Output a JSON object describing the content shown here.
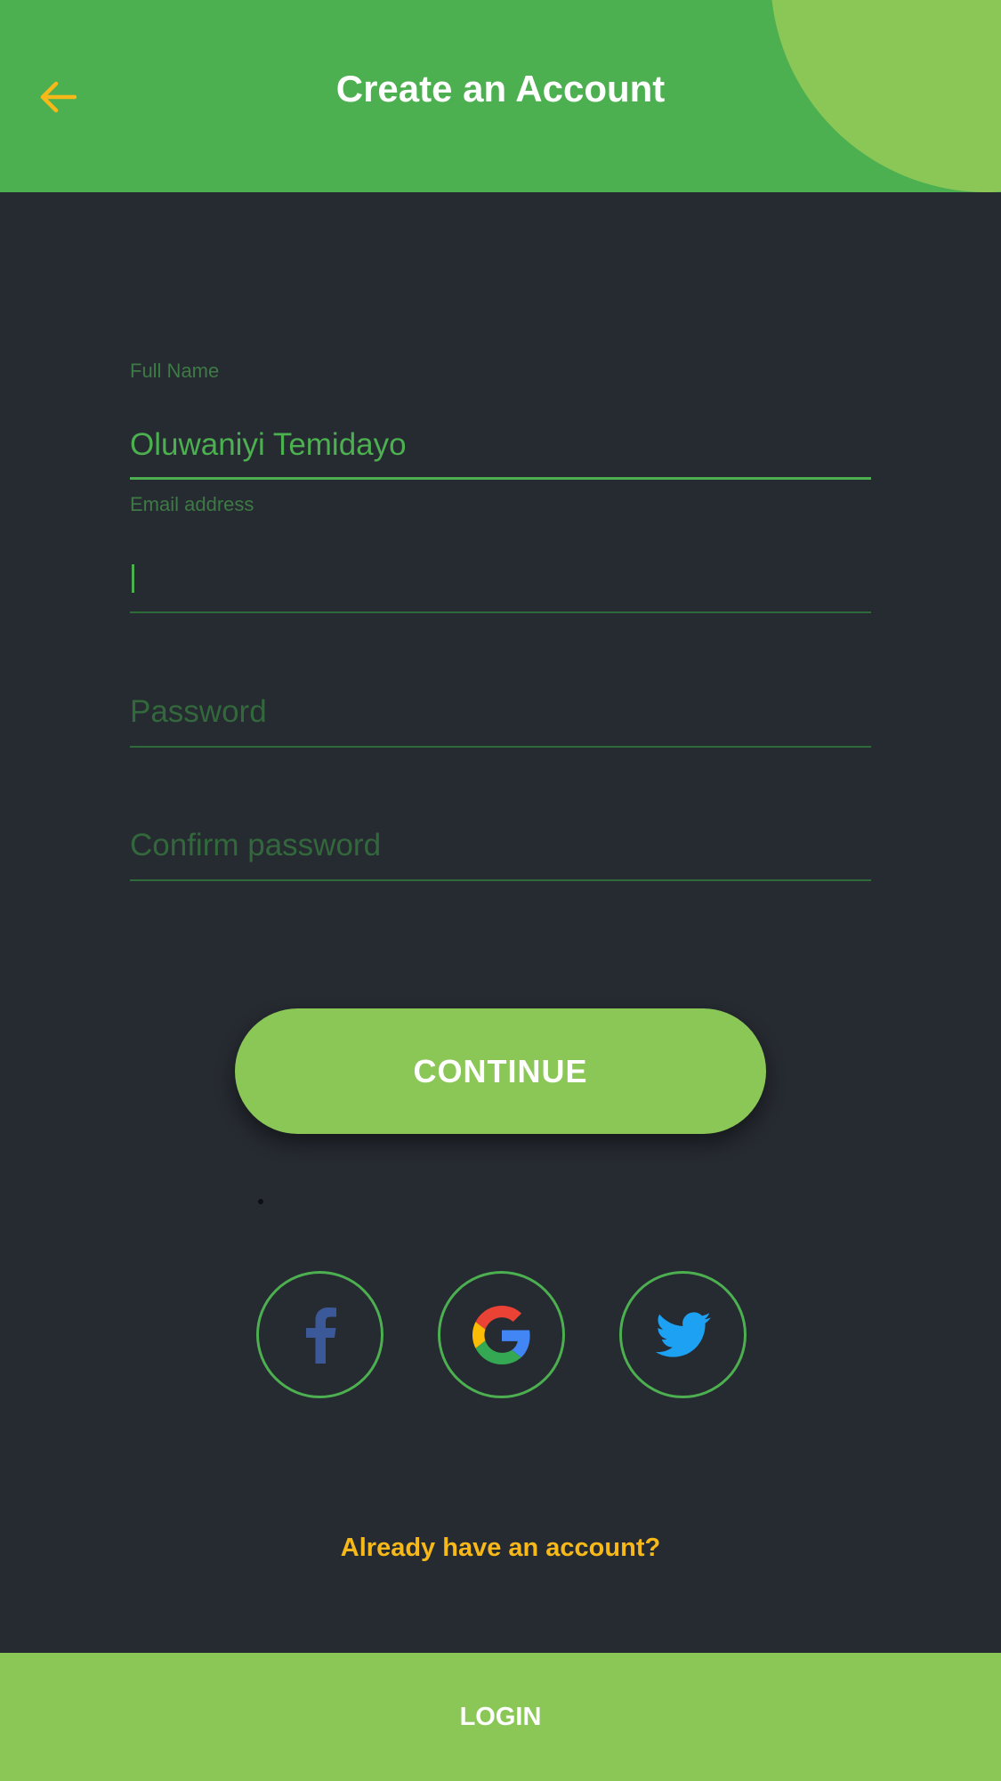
{
  "colors": {
    "header_bg": "#4caf50",
    "header_blob": "#8bc757",
    "page_bg": "#262a31",
    "accent_green": "#4caf50",
    "light_green": "#8bc757",
    "yellow": "#f6b919",
    "facebook": "#3b5998",
    "twitter": "#1da1f2"
  },
  "header": {
    "title": "Create an Account",
    "back_icon": "arrow-left-icon"
  },
  "form": {
    "full_name": {
      "label": "Full Name",
      "value": "Oluwaniyi Temidayo"
    },
    "email": {
      "label": "Email address",
      "value": ""
    },
    "password": {
      "placeholder": "Password"
    },
    "confirm_password": {
      "placeholder": "Confirm password"
    }
  },
  "continue_button": {
    "label": "CONTINUE"
  },
  "social": [
    {
      "icon": "facebook-icon"
    },
    {
      "icon": "google-icon"
    },
    {
      "icon": "twitter-icon"
    }
  ],
  "already_account": "Already have an account?",
  "login_bar": {
    "label": "LOGIN"
  }
}
